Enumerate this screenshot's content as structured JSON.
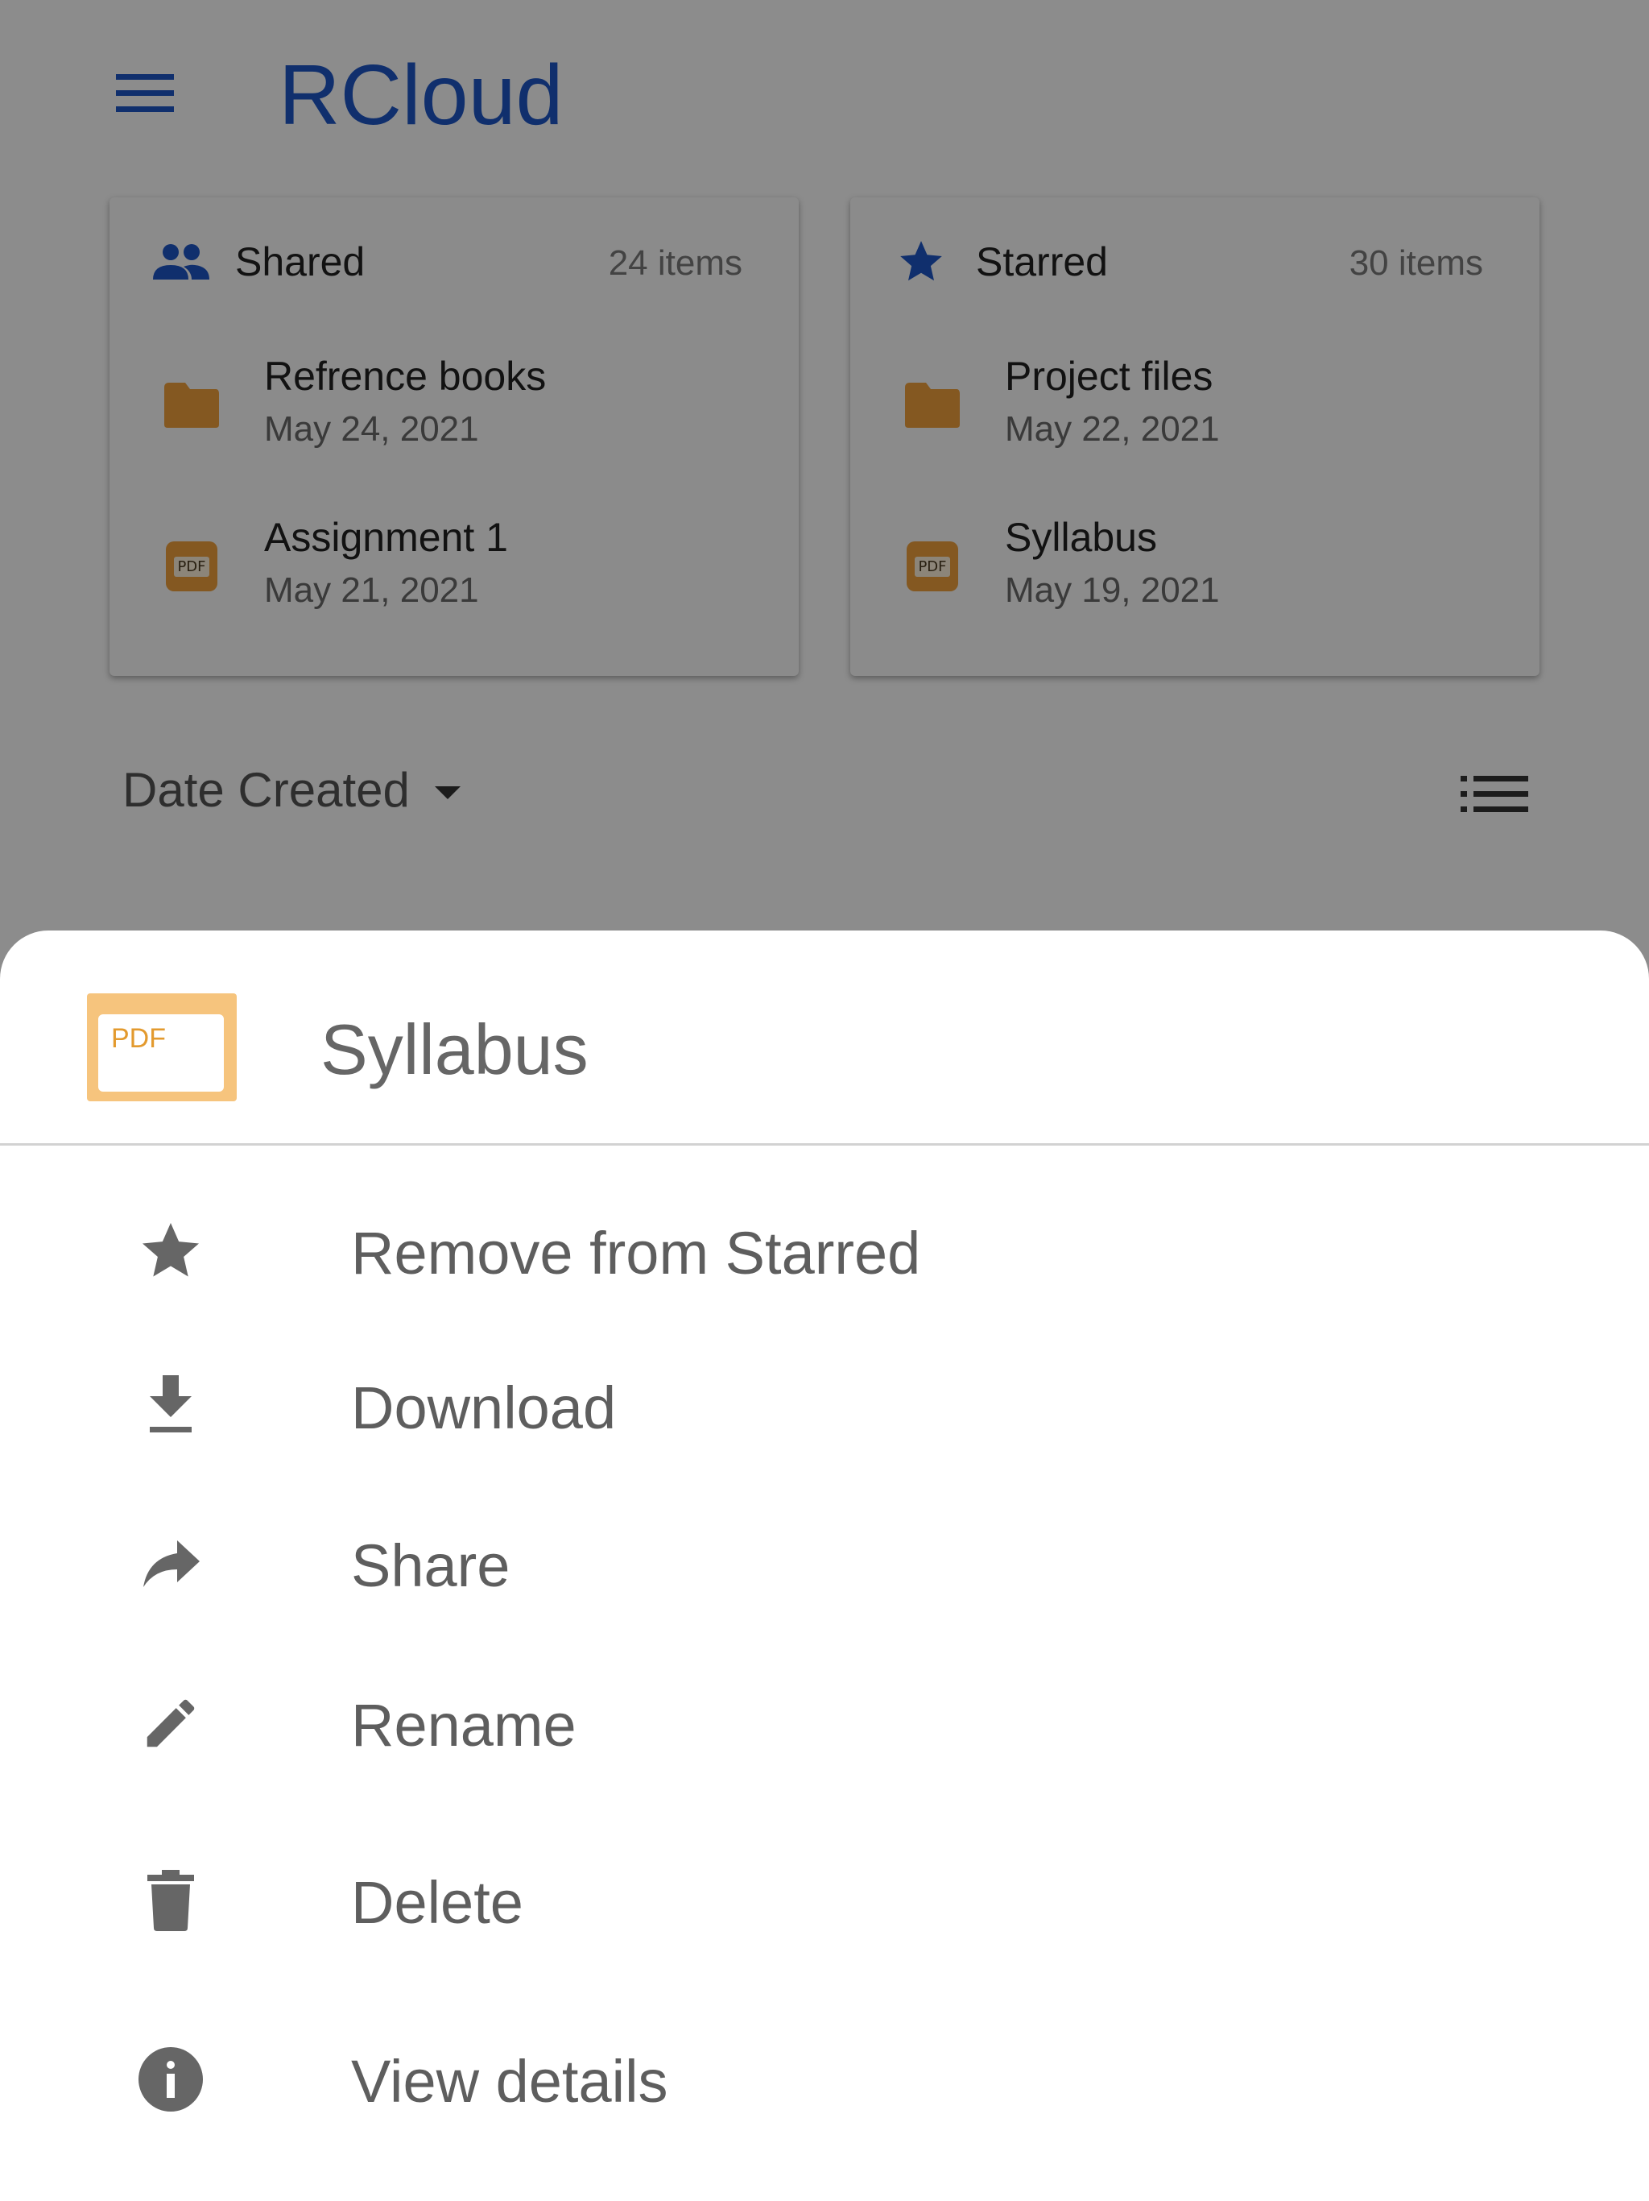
{
  "app": {
    "title": "RCloud"
  },
  "cards": [
    {
      "title": "Shared",
      "count": "24 items",
      "icon": "people-icon",
      "items": [
        {
          "name": "Refrence books",
          "date": "May 24, 2021",
          "icon": "folder-icon"
        },
        {
          "name": "Assignment 1",
          "date": "May 21, 2021",
          "icon": "pdf-icon",
          "badge": "PDF"
        }
      ]
    },
    {
      "title": "Starred",
      "count": "30 items",
      "icon": "star-icon",
      "items": [
        {
          "name": "Project files",
          "date": "May 22, 2021",
          "icon": "folder-icon"
        },
        {
          "name": "Syllabus",
          "date": "May 19, 2021",
          "icon": "pdf-icon",
          "badge": "PDF"
        }
      ]
    }
  ],
  "sort": {
    "label": "Date Created"
  },
  "sheet": {
    "file_name": "Syllabus",
    "file_badge": "PDF",
    "actions": [
      {
        "label": "Remove from Starred",
        "icon": "star-icon"
      },
      {
        "label": "Download",
        "icon": "download-icon"
      },
      {
        "label": "Share",
        "icon": "share-icon"
      },
      {
        "label": "Rename",
        "icon": "pencil-icon"
      },
      {
        "label": "Delete",
        "icon": "trash-icon"
      },
      {
        "label": "View details",
        "icon": "info-icon"
      }
    ]
  },
  "colors": {
    "brand": "#1e57c6",
    "folder": "#f0a03c",
    "scrim": "rgba(0,0,0,0.45)",
    "action_icon": "#666666"
  }
}
